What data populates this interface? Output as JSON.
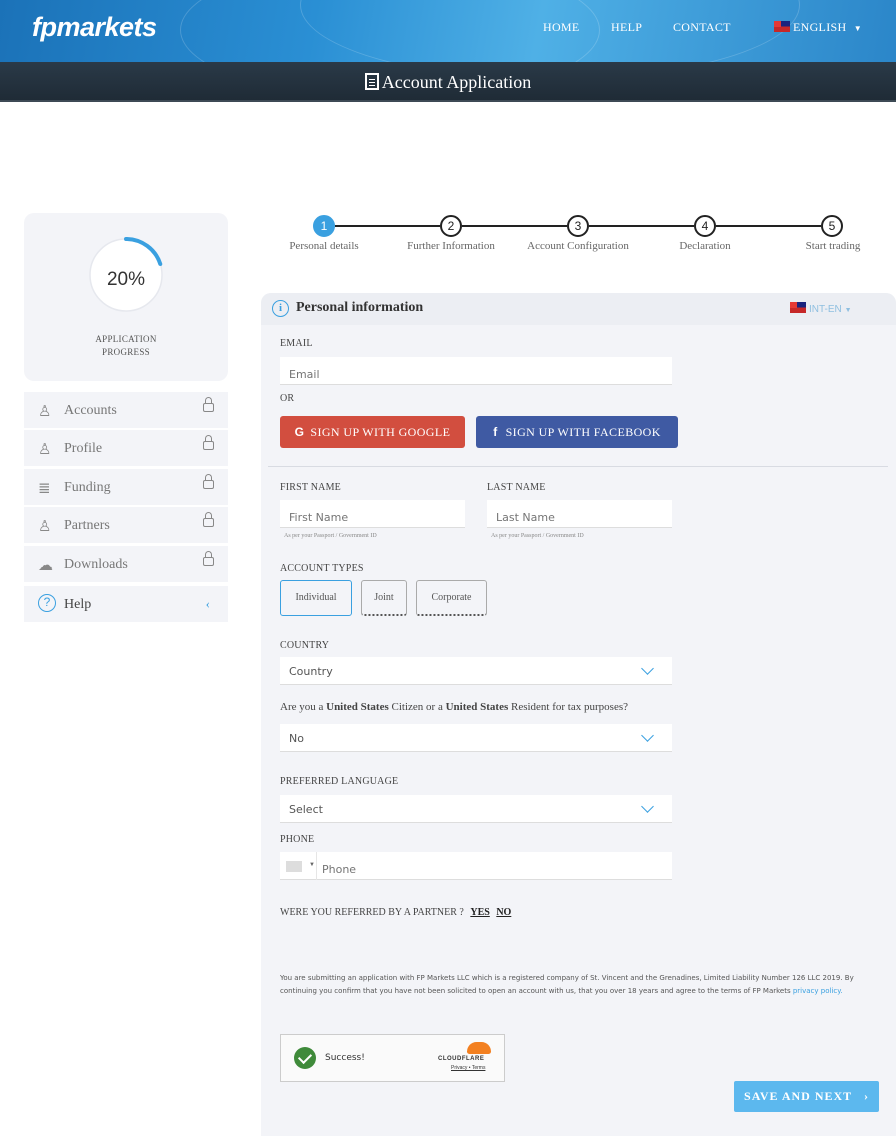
{
  "header": {
    "logo": "fpmarkets",
    "nav": {
      "home": "HOME",
      "help": "HELP",
      "contact": "CONTACT",
      "language": "ENGLISH"
    },
    "page_title": "Account Application"
  },
  "sidebar": {
    "progress_value": "20%",
    "progress_fraction": 0.2,
    "progress_label_line1": "APPLICATION",
    "progress_label_line2": "PROGRESS",
    "items": [
      {
        "label": "Accounts",
        "icon": "user-icon",
        "locked": true
      },
      {
        "label": "Profile",
        "icon": "user-plus-icon",
        "locked": true
      },
      {
        "label": "Funding",
        "icon": "database-icon",
        "locked": true
      },
      {
        "label": "Partners",
        "icon": "users-icon",
        "locked": true
      },
      {
        "label": "Downloads",
        "icon": "cloud-download-icon",
        "locked": true
      },
      {
        "label": "Help",
        "icon": "help-icon",
        "locked": false
      }
    ]
  },
  "stepper": {
    "steps": [
      {
        "num": "1",
        "label": "Personal details",
        "active": true
      },
      {
        "num": "2",
        "label": "Further Information",
        "active": false
      },
      {
        "num": "3",
        "label": "Account Configuration",
        "active": false
      },
      {
        "num": "4",
        "label": "Declaration",
        "active": false
      },
      {
        "num": "5",
        "label": "Start trading",
        "active": false
      }
    ]
  },
  "form": {
    "section_title": "Personal information",
    "region_select": "INT-EN",
    "email_label": "EMAIL",
    "email_placeholder": "Email",
    "or_text": "OR",
    "google_button": "SIGN UP WITH GOOGLE",
    "facebook_button": "SIGN UP WITH FACEBOOK",
    "first_name_label": "FIRST NAME",
    "first_name_placeholder": "First Name",
    "last_name_label": "LAST NAME",
    "last_name_placeholder": "Last Name",
    "name_hint": "As per your Passport / Government ID",
    "account_types_label": "ACCOUNT TYPES",
    "account_types": [
      {
        "label": "Individual",
        "selected": true
      },
      {
        "label": "Joint",
        "selected": false
      },
      {
        "label": "Corporate",
        "selected": false
      }
    ],
    "country_label": "COUNTRY",
    "country_value": "Country",
    "tax_question": {
      "part1": "Are you a ",
      "bold1": "United States",
      "part2": " Citizen or a ",
      "bold2": "United States",
      "part3": " Resident for tax purposes?"
    },
    "tax_value": "No",
    "preferred_language_label": "PREFERRED LANGUAGE",
    "preferred_language_value": "Select",
    "phone_label": "PHONE",
    "phone_placeholder": "Phone",
    "referred_question": "WERE YOU REFERRED BY A PARTNER ?",
    "referred_yes": "YES",
    "referred_no": "NO",
    "legal_text": "You are submitting an application with FP Markets LLC which is a registered company of St. Vincent and the Grenadines, Limited Liability Number 126 LLC 2019. By continuing you confirm that you have not been solicited to open an account with us, that you over 18 years and agree to the terms of FP Markets ",
    "legal_link": "privacy policy.",
    "captcha_status": "Success!",
    "captcha_brand": "CLOUDFLARE",
    "captcha_links": "Privacy • Terms",
    "save_button": "SAVE AND NEXT"
  },
  "colors": {
    "accent": "#3aa0e0",
    "google": "#d24e3f",
    "facebook": "#3f5aa3",
    "header_dark": "#1f2b36",
    "save": "#5cb8ee"
  }
}
